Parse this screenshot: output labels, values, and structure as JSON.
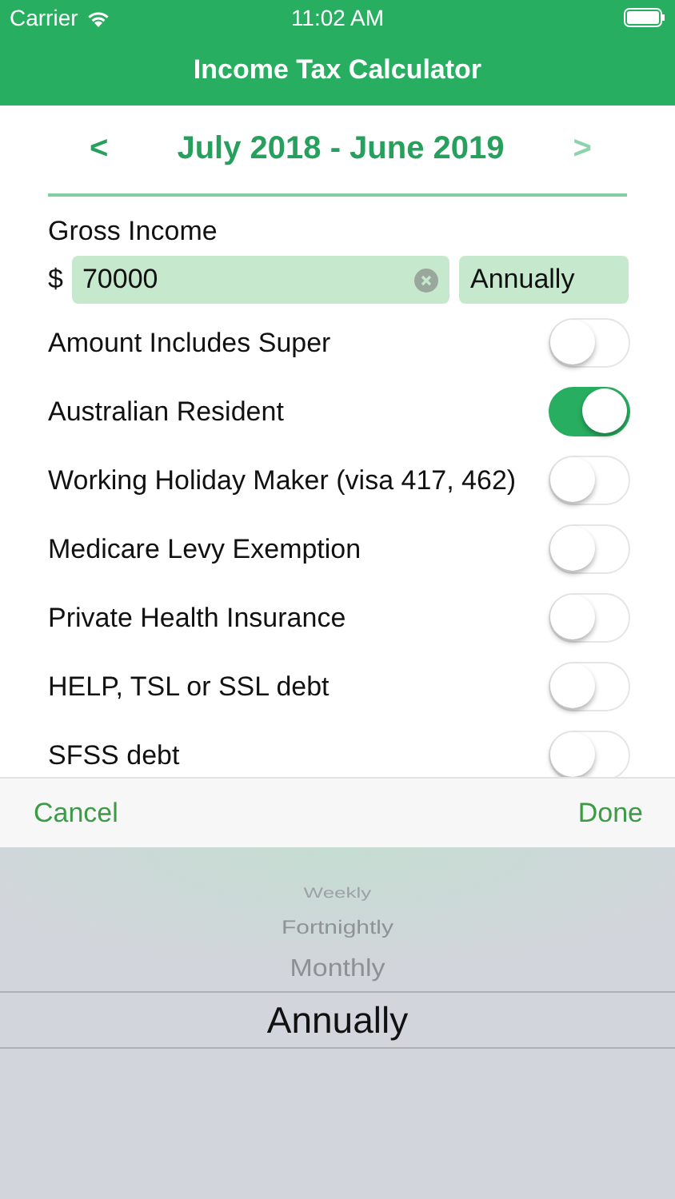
{
  "status_bar": {
    "carrier": "Carrier",
    "time": "11:02 AM"
  },
  "nav": {
    "title": "Income Tax Calculator"
  },
  "year_selector": {
    "prev": {
      "text": "<",
      "disabled": false
    },
    "label": "July 2018 - June 2019",
    "next": {
      "text": ">",
      "disabled": true
    }
  },
  "gross_income": {
    "label": "Gross Income",
    "currency": "$",
    "value": "70000",
    "period": "Annually"
  },
  "options": [
    {
      "label": "Amount Includes Super",
      "on": false
    },
    {
      "label": "Australian Resident",
      "on": true
    },
    {
      "label": "Working Holiday Maker (visa 417, 462)",
      "on": false
    },
    {
      "label": "Medicare Levy Exemption",
      "on": false
    },
    {
      "label": "Private Health Insurance",
      "on": false
    },
    {
      "label": "HELP, TSL or SSL debt",
      "on": false
    },
    {
      "label": "SFSS debt",
      "on": false
    }
  ],
  "toolbar": {
    "cancel": "Cancel",
    "done": "Done"
  },
  "picker": {
    "options": [
      {
        "label": "Weekly",
        "selected": false
      },
      {
        "label": "Fortnightly",
        "selected": false
      },
      {
        "label": "Monthly",
        "selected": false
      },
      {
        "label": "Annually",
        "selected": true
      }
    ]
  }
}
